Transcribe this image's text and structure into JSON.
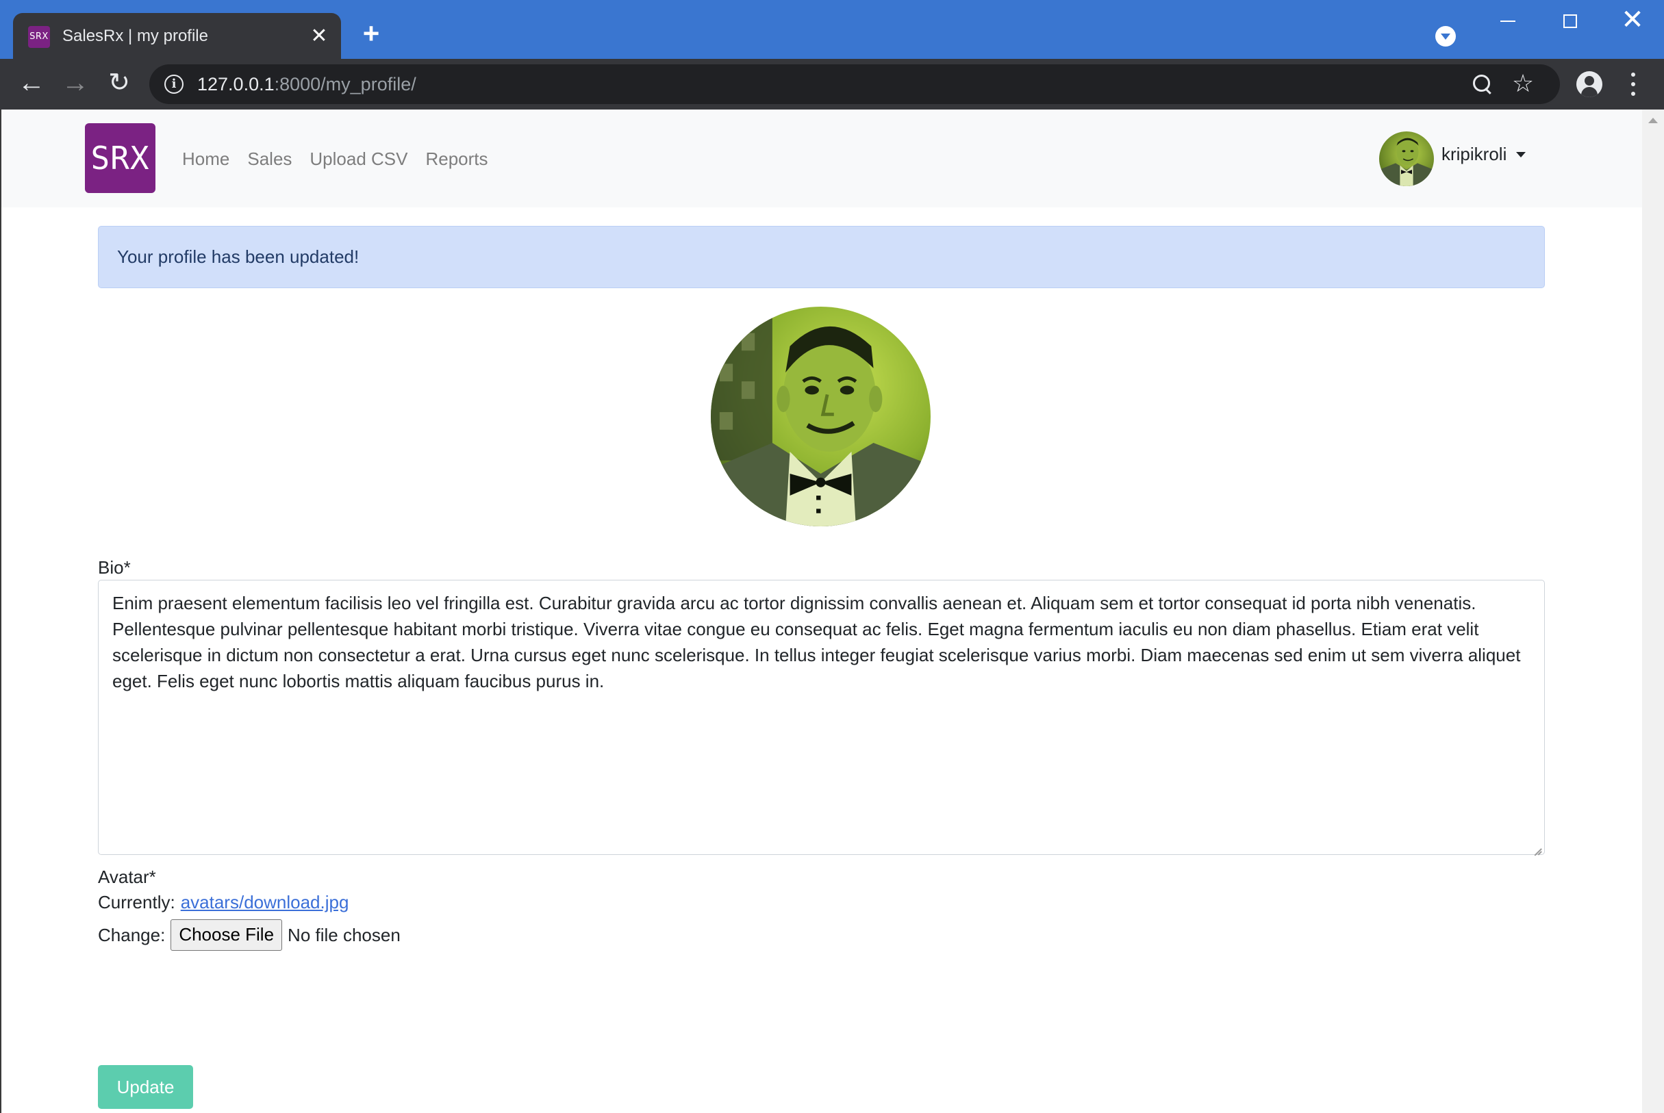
{
  "browser": {
    "tab": {
      "favicon_text": "SRX",
      "title": "SalesRx | my profile"
    },
    "url": {
      "host": "127.0.0.1",
      "path": ":8000/my_profile/"
    },
    "icons": [
      "back-arrow-icon",
      "forward-arrow-icon",
      "reload-icon",
      "info-icon",
      "zoom-icon",
      "star-icon",
      "profile-icon",
      "menu-icon",
      "tab-search-icon",
      "close-icon",
      "plus-icon"
    ],
    "colors": {
      "titlebar": "#3a76d0",
      "toolbar": "#35363a",
      "omnibox": "#202124"
    }
  },
  "site": {
    "logo_text": "SRX",
    "brand_color": "#7b2283",
    "nav": [
      "Home",
      "Sales",
      "Upload CSV",
      "Reports"
    ],
    "user": {
      "name": "kripikroli"
    }
  },
  "alert": {
    "message": "Your profile has been updated!",
    "color": "#d1dffa"
  },
  "form": {
    "bio_label": "Bio*",
    "bio_value": "Enim praesent elementum facilisis leo vel fringilla est. Curabitur gravida arcu ac tortor dignissim convallis aenean et. Aliquam sem et tortor consequat id porta nibh venenatis. Pellentesque pulvinar pellentesque habitant morbi tristique. Viverra vitae congue eu consequat ac felis. Eget magna fermentum iaculis eu non diam phasellus. Etiam erat velit scelerisque in dictum non consectetur a erat. Urna cursus eget nunc scelerisque. In tellus integer feugiat scelerisque varius morbi. Diam maecenas sed enim ut sem viverra aliquet eget. Felis eget nunc lobortis mattis aliquam faucibus purus in.",
    "avatar_label": "Avatar*",
    "currently_label": "Currently:",
    "current_file": "avatars/download.jpg",
    "change_label": "Change:",
    "choose_file_label": "Choose File",
    "file_status": "No file chosen",
    "submit_label": "Update",
    "submit_color": "#5ccdae"
  }
}
